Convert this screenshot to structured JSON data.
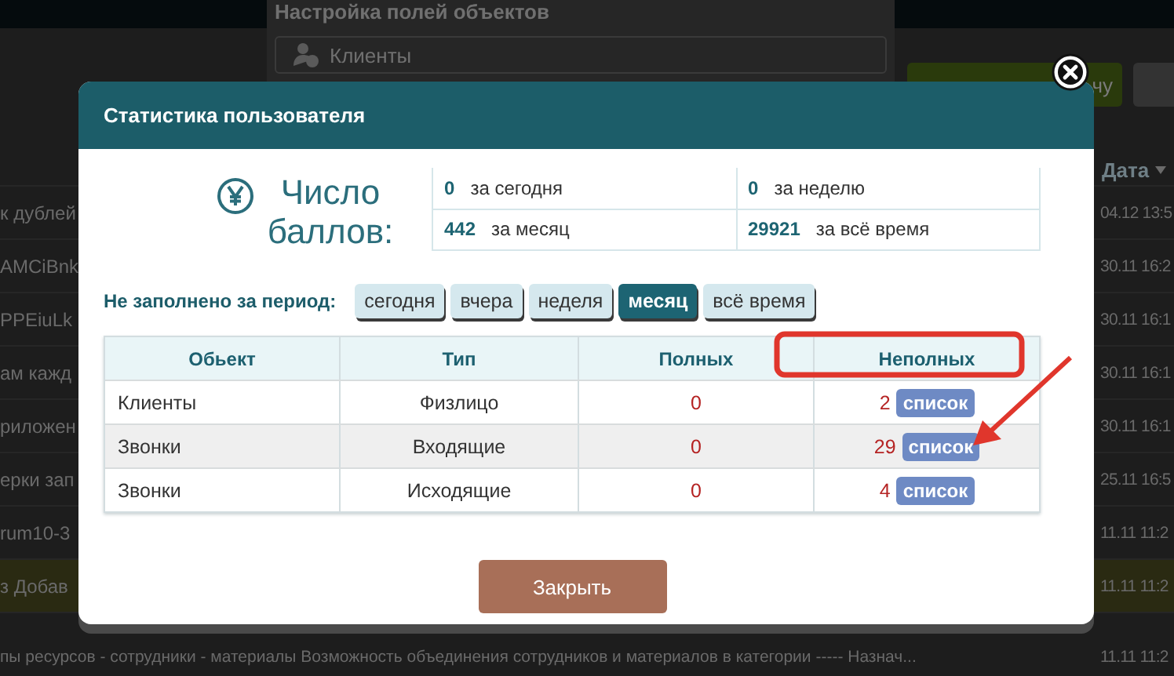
{
  "background": {
    "panel_title": "Настройка полей объектов",
    "panel_field": "Клиенты",
    "button_text": "чу",
    "date_header": "Дата",
    "rows": [
      {
        "text": "к дублей",
        "date": "04.12 13:5",
        "highlighted": false
      },
      {
        "text": "AMCiBnk",
        "date": "30.11 16:2",
        "highlighted": false
      },
      {
        "text": "PPEiuLk",
        "date": "30.11 16:1",
        "highlighted": false
      },
      {
        "text": "ам кажд",
        "date": "30.11 16:1",
        "highlighted": false
      },
      {
        "text": "риложен",
        "date": "30.11 16:1",
        "highlighted": false
      },
      {
        "text": "ерки зап",
        "date": "25.11 16:5",
        "highlighted": false
      },
      {
        "text": "rum10-3",
        "date": "11.11 11:2",
        "highlighted": false
      },
      {
        "text": "з Добав",
        "date": "11.11 11:2",
        "highlighted": true
      },
      {
        "text": "пы ресурсов - сотрудники - материалы Возможность объединения сотрудников и материалов в категории ----- Назнач...",
        "date": "11.11 11:2",
        "highlighted": false
      }
    ]
  },
  "dialog": {
    "title": "Статистика пользователя",
    "score": {
      "label": "Число баллов:",
      "stats": [
        {
          "value": "0",
          "label": "за сегодня"
        },
        {
          "value": "0",
          "label": "за неделю"
        },
        {
          "value": "442",
          "label": "за месяц"
        },
        {
          "value": "29921",
          "label": "за всё время"
        }
      ]
    },
    "filter": {
      "label": "Не заполнено за период:",
      "periods": [
        {
          "label": "сегодня",
          "selected": false
        },
        {
          "label": "вчера",
          "selected": false
        },
        {
          "label": "неделя",
          "selected": false
        },
        {
          "label": "месяц",
          "selected": true
        },
        {
          "label": "всё время",
          "selected": false
        }
      ]
    },
    "table": {
      "columns": [
        "Обьект",
        "Тип",
        "Полных",
        "Неполных"
      ],
      "rows": [
        {
          "object": "Клиенты",
          "type": "Физлицо",
          "full": "0",
          "incomplete": "2",
          "button": "список"
        },
        {
          "object": "Звонки",
          "type": "Входящие",
          "full": "0",
          "incomplete": "29",
          "button": "список"
        },
        {
          "object": "Звонки",
          "type": "Исходящие",
          "full": "0",
          "incomplete": "4",
          "button": "список"
        }
      ]
    },
    "close_button": "Закрыть"
  }
}
